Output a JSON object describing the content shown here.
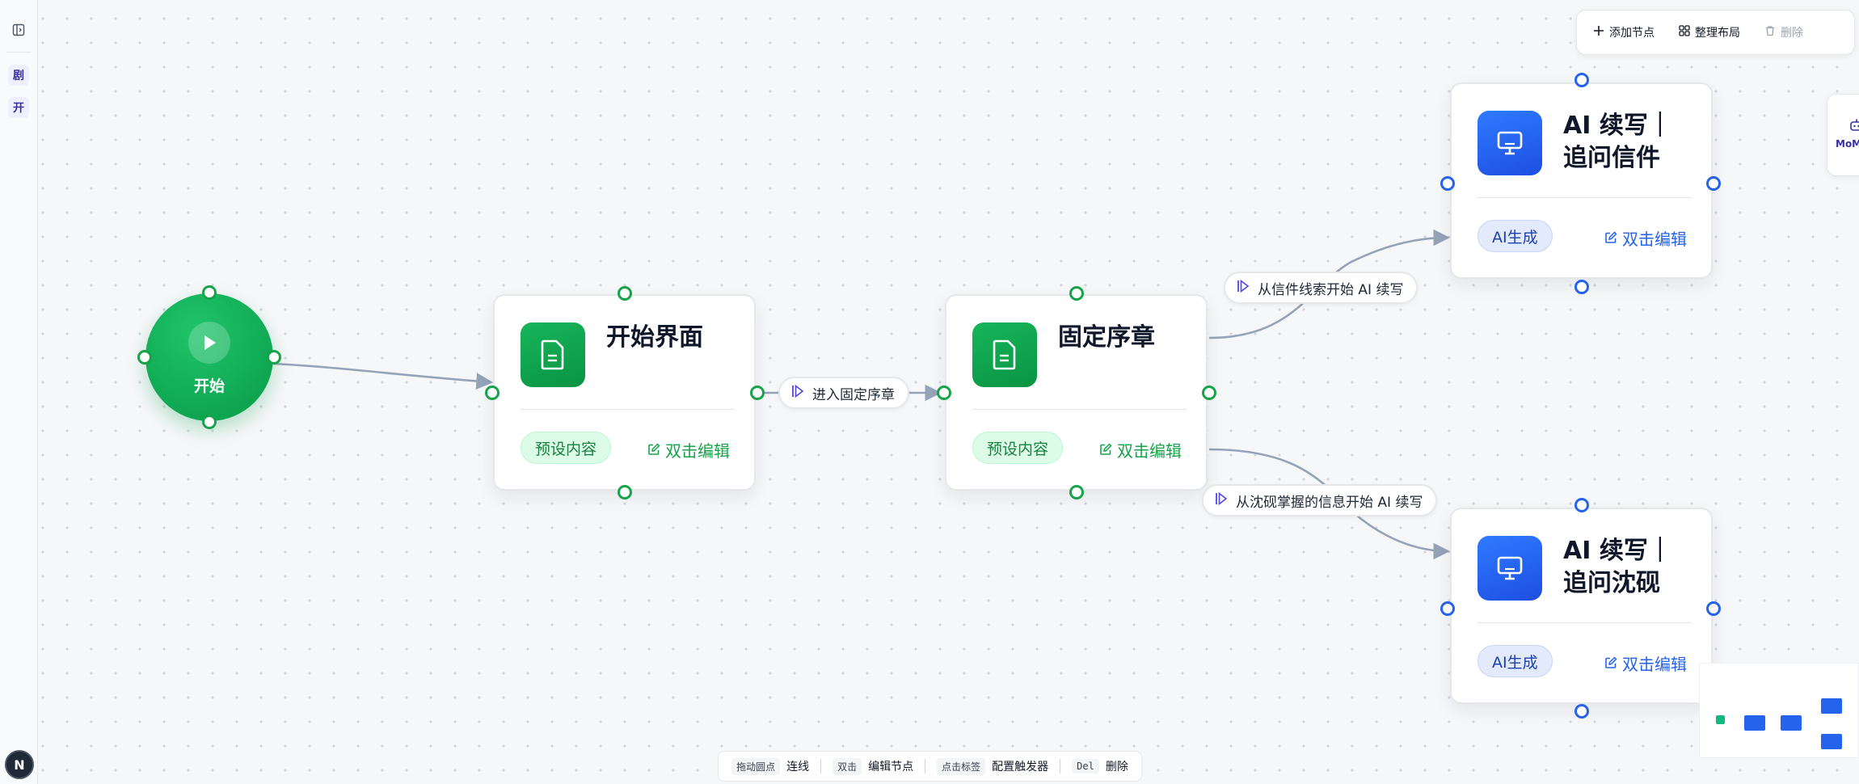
{
  "rail": {
    "chips": [
      {
        "label": "剧"
      },
      {
        "label": "开"
      }
    ],
    "avatar_letter": "N"
  },
  "toolbar": {
    "add_node": "添加节点",
    "tidy_layout": "整理布局",
    "delete": "删除"
  },
  "side_card": {
    "label": "MoMo"
  },
  "start_node": {
    "label": "开始"
  },
  "nodes": [
    {
      "title_lines": [
        "开始界面"
      ],
      "badge": "预设内容",
      "edit": "双击编辑",
      "theme": "green"
    },
    {
      "title_lines": [
        "固定序章"
      ],
      "badge": "预设内容",
      "edit": "双击编辑",
      "theme": "green"
    },
    {
      "title_lines": [
        "AI 续写｜",
        "追问信件"
      ],
      "badge": "AI生成",
      "edit": "双击编辑",
      "theme": "blue"
    },
    {
      "title_lines": [
        "AI 续写｜",
        "追问沈砚"
      ],
      "badge": "AI生成",
      "edit": "双击编辑",
      "theme": "blue"
    }
  ],
  "edge_labels": [
    "进入固定序章",
    "从信件线索开始 AI 续写",
    "从沈砚掌握的信息开始 AI 续写"
  ],
  "hints": [
    {
      "key": "拖动圆点",
      "action": "连线"
    },
    {
      "key": "双击",
      "action": "编辑节点"
    },
    {
      "key": "点击标签",
      "action": "配置触发器"
    },
    {
      "key": "Del",
      "action": "删除"
    }
  ],
  "colors": {
    "green": "#16a34a",
    "blue": "#2563eb",
    "edge": "#94a3b8",
    "accent_purple": "#3730a3"
  }
}
